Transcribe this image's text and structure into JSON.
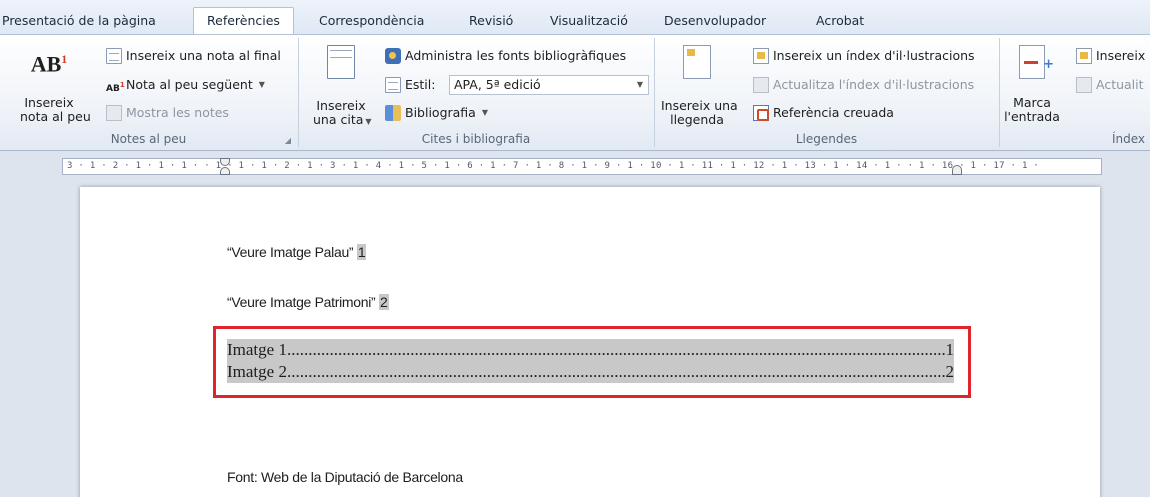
{
  "tabs": [
    {
      "label": "Presentació de la pàgina"
    },
    {
      "label": "Referències"
    },
    {
      "label": "Correspondència"
    },
    {
      "label": "Revisió"
    },
    {
      "label": "Visualització"
    },
    {
      "label": "Desenvolupador"
    },
    {
      "label": "Acrobat"
    }
  ],
  "ribbon": {
    "footnotes": {
      "insert_footnote": "Insereix nota al peu",
      "insert_footnote_line1": "Insereix",
      "insert_footnote_line2": "nota al peu",
      "big_icon_text": "AB",
      "big_icon_sup": "1",
      "insert_endnote": "Insereix una nota al final",
      "next_footnote": "Nota al peu següent",
      "show_notes": "Mostra les notes",
      "label": "Notes al peu"
    },
    "citations": {
      "insert_citation_line1": "Insereix",
      "insert_citation_line2": "una cita",
      "manage_sources": "Administra les fonts bibliogràfiques",
      "style_label": "Estil:",
      "style_value": "APA, 5ª edició",
      "bibliography": "Bibliografia",
      "label": "Cites i bibliografia"
    },
    "captions": {
      "insert_caption_line1": "Insereix una",
      "insert_caption_line2": "llegenda",
      "insert_table_of_figures": "Insereix un índex d'il·lustracions",
      "update_table": "Actualitza l'índex d'il·lustracions",
      "cross_reference": "Referència creuada",
      "label": "Llegendes"
    },
    "index": {
      "mark_entry_line1": "Marca",
      "mark_entry_line2": "l'entrada",
      "insert_index": "Insereix",
      "update_index": "Actualit",
      "label": "Índex"
    }
  },
  "ruler": {
    "text": "3 · 1 · 2 · 1 · 1 · 1 ·    · 1 · 1 · 1 · 2 · 1 · 3 · 1 · 4 · 1 · 5 · 1 · 6 · 1 · 7 · 1 · 8 · 1 · 9 · 1 · 10 · 1 · 11 · 1 · 12 · 1 · 13 · 1 · 14 · 1 ·    · 1 · 16 · 1 · 17 · 1 ·"
  },
  "document": {
    "line1_text": "“Veure Imatge Palau”",
    "line1_ref": "1",
    "line2_text": "“Veure Imatge Patrimoni”",
    "line2_ref": "2",
    "toc": [
      {
        "title": "Imatge 1",
        "page": "1"
      },
      {
        "title": "Imatge 2",
        "page": "2"
      }
    ],
    "source": "Font: Web de la Diputació de Barcelona"
  },
  "colors": {
    "highlight_border": "#e0242c",
    "field_shading": "#c8c8c8"
  }
}
